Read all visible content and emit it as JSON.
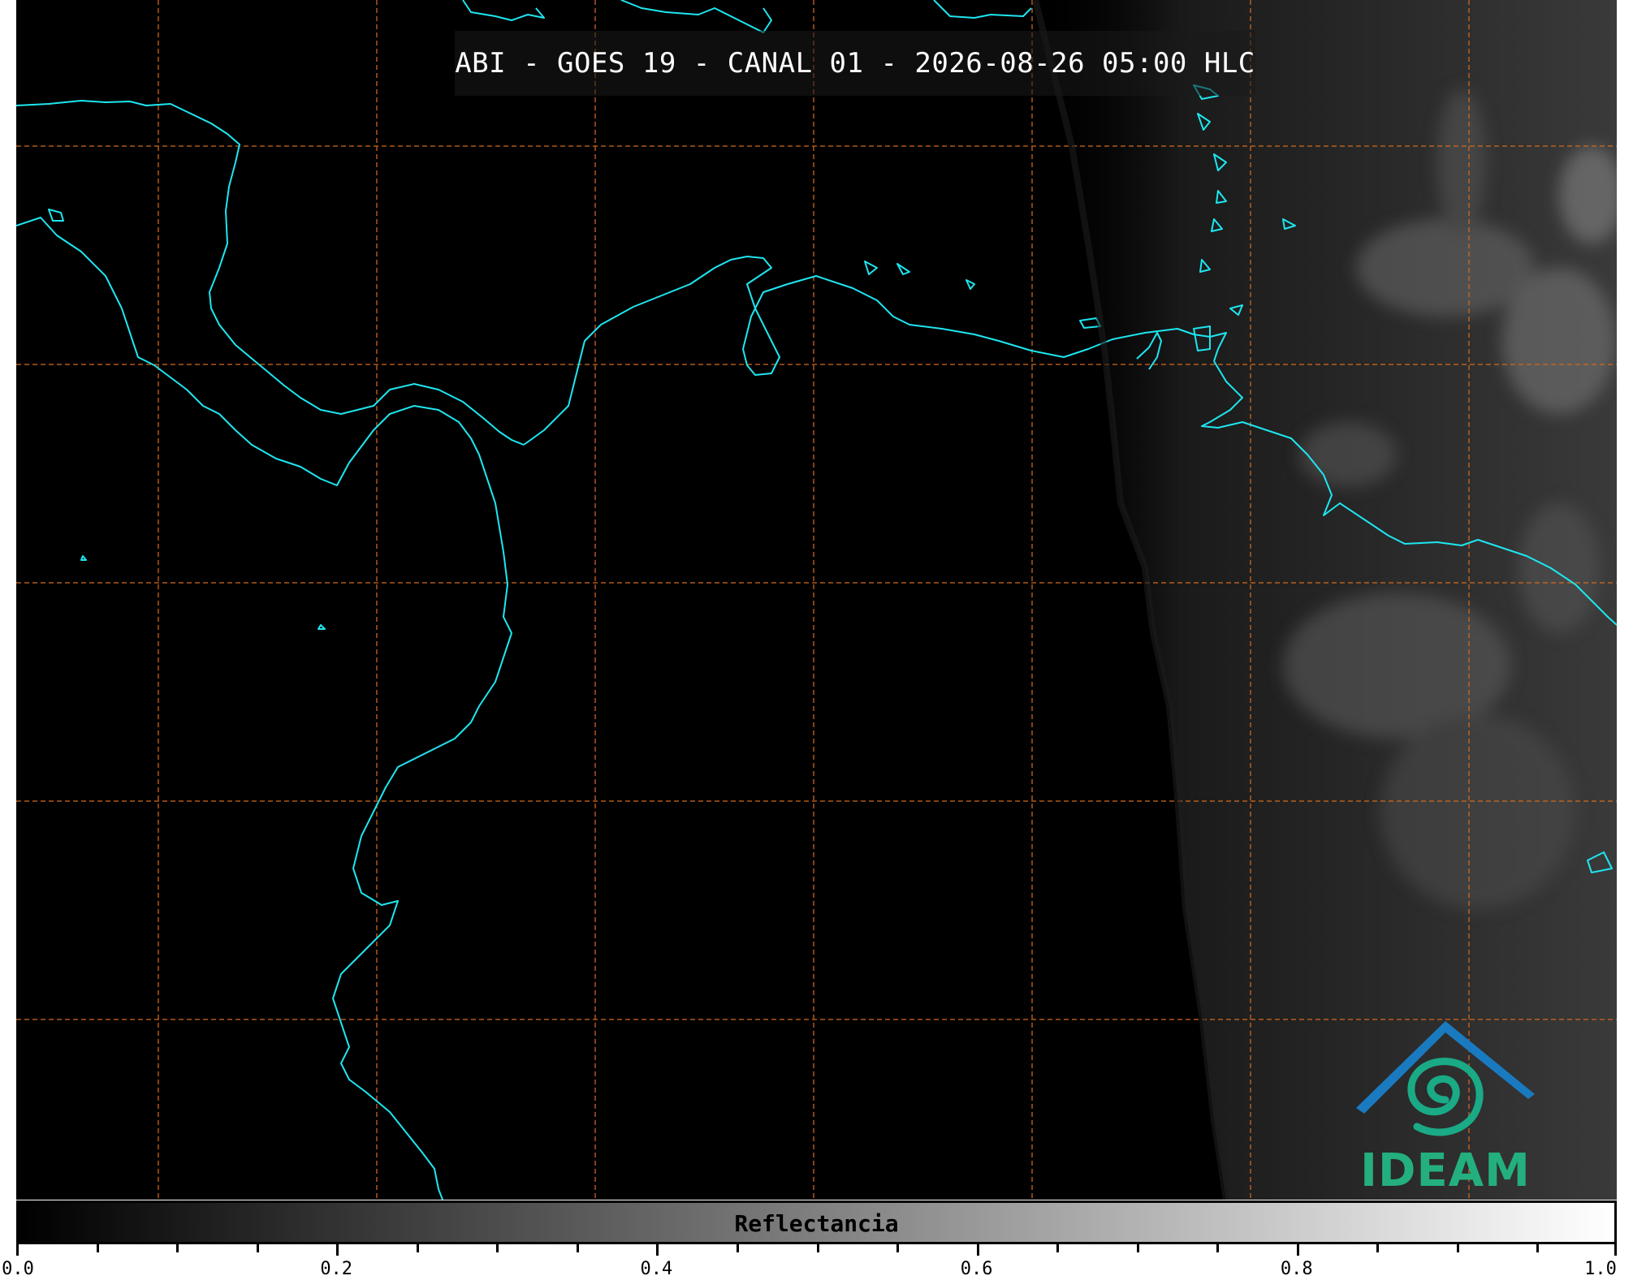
{
  "title": "ABI - GOES 19 - CANAL 01 - 2026-08-26 05:00 HLC",
  "colors": {
    "coastline": "#1ee6f0",
    "grid": "#d2691e",
    "logo_mountain": "#1a7ac0",
    "logo_spiral": "#1aaa86",
    "logo_text": "#23b07e"
  },
  "logo": {
    "text": "IDEAM"
  },
  "colorbar": {
    "label": "Reflectancia",
    "min": 0.0,
    "max": 1.0,
    "tick_labels": [
      "0.0",
      "0.2",
      "0.4",
      "0.6",
      "0.8",
      "1.0"
    ],
    "minor_step": 0.05
  }
}
